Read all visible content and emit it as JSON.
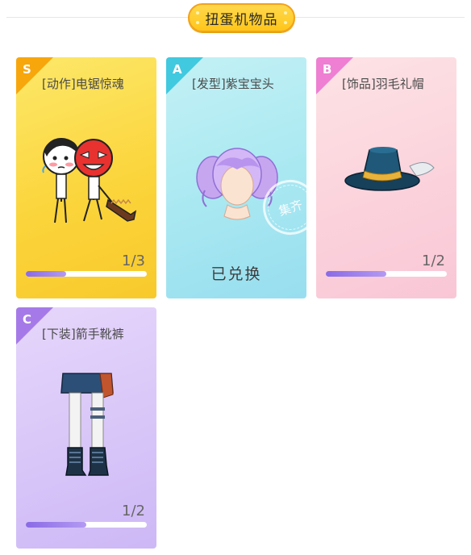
{
  "header": {
    "title": "扭蛋机物品"
  },
  "cards": [
    {
      "rank": "S",
      "title": "[动作]电锯惊魂",
      "count": "1/3",
      "progress": 0.33,
      "art_icon": "chainsaw-comic-icon"
    },
    {
      "rank": "A",
      "title": "[发型]紫宝宝头",
      "status": "已兑换",
      "stamp": "集齐",
      "art_icon": "purple-hair-icon"
    },
    {
      "rank": "B",
      "title": "[饰品]羽毛礼帽",
      "count": "1/2",
      "progress": 0.5,
      "art_icon": "feather-top-hat-icon"
    },
    {
      "rank": "C",
      "title": "[下装]箭手靴裤",
      "count": "1/2",
      "progress": 0.5,
      "art_icon": "archer-boots-pants-icon"
    }
  ],
  "colors": {
    "header_pill": "#ffc61a",
    "rank_s": "#f7a60c",
    "rank_a": "#41c9df",
    "rank_b": "#ee7fd2",
    "rank_c": "#a57ae8",
    "progress_fill": "#8a6ae6"
  }
}
